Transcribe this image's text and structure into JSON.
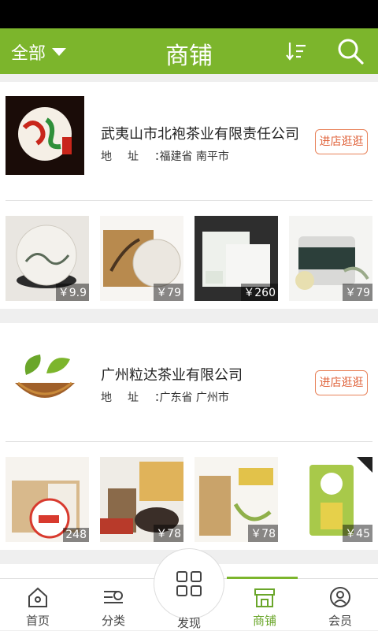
{
  "header": {
    "filter_label": "全部",
    "title": "商铺"
  },
  "stores": [
    {
      "name": "武夷山市北袍茶业有限责任公司",
      "address_label": "地址：",
      "address": "福建省 南平市",
      "visit_label": "进店逛逛",
      "goods": [
        {
          "price": "￥9.9"
        },
        {
          "price": "￥79"
        },
        {
          "price": "￥260"
        },
        {
          "price": "￥79"
        }
      ]
    },
    {
      "name": "广州粒达茶业有限公司",
      "address_label": "地址：",
      "address": "广东省 广州市",
      "visit_label": "进店逛逛",
      "goods": [
        {
          "price": "248"
        },
        {
          "price": "￥78"
        },
        {
          "price": "￥78"
        },
        {
          "price": "￥45"
        }
      ]
    }
  ],
  "tabbar": {
    "home": "首页",
    "category": "分类",
    "discover": "发现",
    "shops": "商铺",
    "member": "会员"
  },
  "colors": {
    "brand_green": "#7cb52c",
    "visit_orange": "#e0643c"
  }
}
